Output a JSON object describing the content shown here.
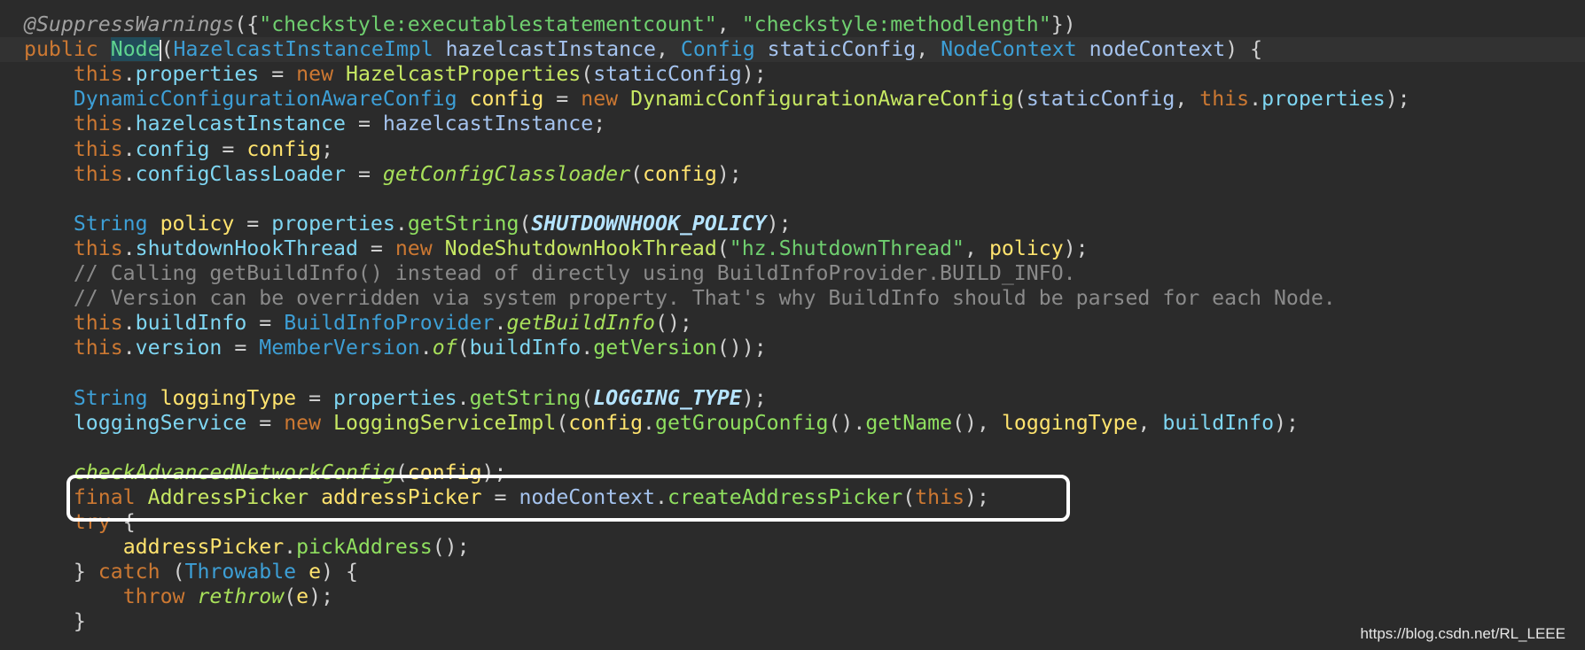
{
  "editor": {
    "lines": [
      [
        [
          "anno",
          "@SuppressWarnings"
        ],
        [
          "plain",
          "({"
        ],
        [
          "str",
          "\"checkstyle:executablestatementcount\""
        ],
        [
          "plain",
          ", "
        ],
        [
          "str",
          "\"checkstyle:methodlength\""
        ],
        [
          "plain",
          "})"
        ]
      ],
      [
        [
          "kw",
          "public "
        ],
        [
          "ctor",
          "Node"
        ],
        [
          "caret",
          ""
        ],
        [
          "plain",
          "("
        ],
        [
          "type",
          "HazelcastInstanceImpl "
        ],
        [
          "param",
          "hazelcastInstance"
        ],
        [
          "plain",
          ", "
        ],
        [
          "type",
          "Config "
        ],
        [
          "param",
          "staticConfig"
        ],
        [
          "plain",
          ", "
        ],
        [
          "type",
          "NodeContext "
        ],
        [
          "param",
          "nodeContext"
        ],
        [
          "plain",
          ") {"
        ]
      ],
      [
        [
          "plain",
          "    "
        ],
        [
          "kw",
          "this"
        ],
        [
          "plain",
          "."
        ],
        [
          "field",
          "properties"
        ],
        [
          "plain",
          " = "
        ],
        [
          "kw",
          "new "
        ],
        [
          "cls",
          "HazelcastProperties"
        ],
        [
          "plain",
          "("
        ],
        [
          "param",
          "staticConfig"
        ],
        [
          "plain",
          ");"
        ]
      ],
      [
        [
          "plain",
          "    "
        ],
        [
          "type",
          "DynamicConfigurationAwareConfig "
        ],
        [
          "local",
          "config"
        ],
        [
          "plain",
          " = "
        ],
        [
          "kw",
          "new "
        ],
        [
          "cls",
          "DynamicConfigurationAwareConfig"
        ],
        [
          "plain",
          "("
        ],
        [
          "param",
          "staticConfig"
        ],
        [
          "plain",
          ", "
        ],
        [
          "kw",
          "this"
        ],
        [
          "plain",
          "."
        ],
        [
          "field",
          "properties"
        ],
        [
          "plain",
          ");"
        ]
      ],
      [
        [
          "plain",
          "    "
        ],
        [
          "kw",
          "this"
        ],
        [
          "plain",
          "."
        ],
        [
          "field",
          "hazelcastInstance"
        ],
        [
          "plain",
          " = "
        ],
        [
          "param",
          "hazelcastInstance"
        ],
        [
          "plain",
          ";"
        ]
      ],
      [
        [
          "plain",
          "    "
        ],
        [
          "kw",
          "this"
        ],
        [
          "plain",
          "."
        ],
        [
          "field",
          "config"
        ],
        [
          "plain",
          " = "
        ],
        [
          "local",
          "config"
        ],
        [
          "plain",
          ";"
        ]
      ],
      [
        [
          "plain",
          "    "
        ],
        [
          "kw",
          "this"
        ],
        [
          "plain",
          "."
        ],
        [
          "field",
          "configClassLoader"
        ],
        [
          "plain",
          " = "
        ],
        [
          "smethod",
          "getConfigClassloader"
        ],
        [
          "plain",
          "("
        ],
        [
          "local",
          "config"
        ],
        [
          "plain",
          ");"
        ]
      ],
      [],
      [
        [
          "plain",
          "    "
        ],
        [
          "type",
          "String "
        ],
        [
          "local",
          "policy"
        ],
        [
          "plain",
          " = "
        ],
        [
          "field",
          "properties"
        ],
        [
          "plain",
          "."
        ],
        [
          "method",
          "getString"
        ],
        [
          "plain",
          "("
        ],
        [
          "const",
          "SHUTDOWNHOOK_POLICY"
        ],
        [
          "plain",
          ");"
        ]
      ],
      [
        [
          "plain",
          "    "
        ],
        [
          "kw",
          "this"
        ],
        [
          "plain",
          "."
        ],
        [
          "field",
          "shutdownHookThread"
        ],
        [
          "plain",
          " = "
        ],
        [
          "kw",
          "new "
        ],
        [
          "cls",
          "NodeShutdownHookThread"
        ],
        [
          "plain",
          "("
        ],
        [
          "str",
          "\"hz.ShutdownThread\""
        ],
        [
          "plain",
          ", "
        ],
        [
          "local",
          "policy"
        ],
        [
          "plain",
          ");"
        ]
      ],
      [
        [
          "plain",
          "    "
        ],
        [
          "cmt",
          "// Calling getBuildInfo() instead of directly using BuildInfoProvider.BUILD_INFO."
        ]
      ],
      [
        [
          "plain",
          "    "
        ],
        [
          "cmt",
          "// Version can be overridden via system property. That's why BuildInfo should be parsed for each Node."
        ]
      ],
      [
        [
          "plain",
          "    "
        ],
        [
          "kw",
          "this"
        ],
        [
          "plain",
          "."
        ],
        [
          "field",
          "buildInfo"
        ],
        [
          "plain",
          " = "
        ],
        [
          "type",
          "BuildInfoProvider"
        ],
        [
          "plain",
          "."
        ],
        [
          "smethod",
          "getBuildInfo"
        ],
        [
          "plain",
          "();"
        ]
      ],
      [
        [
          "plain",
          "    "
        ],
        [
          "kw",
          "this"
        ],
        [
          "plain",
          "."
        ],
        [
          "field",
          "version"
        ],
        [
          "plain",
          " = "
        ],
        [
          "type",
          "MemberVersion"
        ],
        [
          "plain",
          "."
        ],
        [
          "smethod",
          "of"
        ],
        [
          "plain",
          "("
        ],
        [
          "field",
          "buildInfo"
        ],
        [
          "plain",
          "."
        ],
        [
          "method",
          "getVersion"
        ],
        [
          "plain",
          "());"
        ]
      ],
      [],
      [
        [
          "plain",
          "    "
        ],
        [
          "type",
          "String "
        ],
        [
          "local",
          "loggingType"
        ],
        [
          "plain",
          " = "
        ],
        [
          "field",
          "properties"
        ],
        [
          "plain",
          "."
        ],
        [
          "method",
          "getString"
        ],
        [
          "plain",
          "("
        ],
        [
          "const",
          "LOGGING_TYPE"
        ],
        [
          "plain",
          ");"
        ]
      ],
      [
        [
          "plain",
          "    "
        ],
        [
          "field",
          "loggingService"
        ],
        [
          "plain",
          " = "
        ],
        [
          "kw",
          "new "
        ],
        [
          "cls",
          "LoggingServiceImpl"
        ],
        [
          "plain",
          "("
        ],
        [
          "local",
          "config"
        ],
        [
          "plain",
          "."
        ],
        [
          "method",
          "getGroupConfig"
        ],
        [
          "plain",
          "()."
        ],
        [
          "method",
          "getName"
        ],
        [
          "plain",
          "(), "
        ],
        [
          "local",
          "loggingType"
        ],
        [
          "plain",
          ", "
        ],
        [
          "field",
          "buildInfo"
        ],
        [
          "plain",
          ");"
        ]
      ],
      [],
      [
        [
          "plain",
          "    "
        ],
        [
          "smethod",
          "checkAdvancedNetworkConfig"
        ],
        [
          "plain",
          "("
        ],
        [
          "local",
          "config"
        ],
        [
          "plain",
          ");"
        ]
      ],
      [
        [
          "plain",
          "    "
        ],
        [
          "kw",
          "final "
        ],
        [
          "cls",
          "AddressPicker "
        ],
        [
          "local",
          "addressPicker"
        ],
        [
          "plain",
          " = "
        ],
        [
          "param",
          "nodeContext"
        ],
        [
          "plain",
          "."
        ],
        [
          "method",
          "createAddressPicker"
        ],
        [
          "plain",
          "("
        ],
        [
          "kw",
          "this"
        ],
        [
          "plain",
          ");"
        ]
      ],
      [
        [
          "plain",
          "    "
        ],
        [
          "kw",
          "try"
        ],
        [
          "plain",
          " {"
        ]
      ],
      [
        [
          "plain",
          "        "
        ],
        [
          "local",
          "addressPicker"
        ],
        [
          "plain",
          "."
        ],
        [
          "method",
          "pickAddress"
        ],
        [
          "plain",
          "();"
        ]
      ],
      [
        [
          "plain",
          "    } "
        ],
        [
          "kw",
          "catch"
        ],
        [
          "plain",
          " ("
        ],
        [
          "type",
          "Throwable "
        ],
        [
          "local",
          "e"
        ],
        [
          "plain",
          ") {"
        ]
      ],
      [
        [
          "plain",
          "        "
        ],
        [
          "kw",
          "throw "
        ],
        [
          "smethod",
          "rethrow"
        ],
        [
          "plain",
          "("
        ],
        [
          "local",
          "e"
        ],
        [
          "plain",
          ");"
        ]
      ],
      [
        [
          "plain",
          "    }"
        ]
      ]
    ]
  },
  "watermark": "https://blog.csdn.net/RL_LEEE"
}
